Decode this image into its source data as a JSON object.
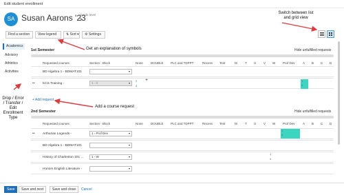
{
  "window": {
    "title": "Edit student enrollment"
  },
  "student": {
    "initials": "SA",
    "name": "Susan Aarons '23",
    "grade_label": "Grade level",
    "grade_value": "9"
  },
  "toolbar": {
    "find_section": "Find a section",
    "view_legend": "View legend",
    "sort": "⇅ Sort ▾",
    "settings": "⚙ Settings"
  },
  "annotations": {
    "switch_view": "Switch between list\nand grid view",
    "legend": "Get an explanation of symbols",
    "drop": "Drop / Error\n/ Transfer /\nEdit\nEnrollment\nType",
    "add_request": "Add a course request"
  },
  "sidebar": {
    "items": [
      "Academics",
      "Advisory",
      "Athletics",
      "Activities"
    ]
  },
  "grid_columns": [
    "Requested courses",
    "Section - Block",
    "None",
    "DOUBLE",
    "PLC and TDPPT",
    "Recess",
    "Test",
    "M",
    "T",
    "U",
    "V",
    "W",
    "Prof Dev",
    "A",
    "B",
    "C",
    "D"
  ],
  "semesters": [
    {
      "title": "1st Semester",
      "hide_link": "Hide unfulfilled requests",
      "rows": [
        {
          "course": "BD Algebra 1 - BDMAT101",
          "section": "",
          "disabled": false,
          "drag": ""
        },
        {
          "course": "KCS Training -",
          "section": "1 - A",
          "disabled": true,
          "drag": "••"
        }
      ],
      "add_request": "+ Add request",
      "teal_numbers": [
        "1",
        "4"
      ]
    },
    {
      "title": "2nd Semester",
      "hide_link": "Hide unfulfilled requests",
      "rows": [
        {
          "course": "Arthurian Legends -",
          "section": "1 - Prof Dev",
          "disabled": false,
          "drag": "••"
        },
        {
          "course": "BD Algebra 1 - BDMAT101",
          "section": "",
          "disabled": false,
          "drag": ""
        },
        {
          "course": "History of Charleston 101 ...",
          "section": "1 - W",
          "disabled": false,
          "drag": ""
        },
        {
          "course": "Honors English Literature -",
          "section": "",
          "disabled": false,
          "drag": ""
        }
      ],
      "teal_numbers": [
        "1",
        "4"
      ]
    }
  ],
  "misc": {
    "blue_top": "2",
    "blue_bottom": "4",
    "plus": "+",
    "w_top": "1",
    "w_bottom": "4"
  },
  "footer": {
    "save": "Save",
    "save_next": "Save and next",
    "save_close": "Save and close",
    "cancel": "Cancel"
  },
  "colors": {
    "accent": "#1e6fb5",
    "teal": "#3cd6c0",
    "arrow": "#e0393e"
  }
}
